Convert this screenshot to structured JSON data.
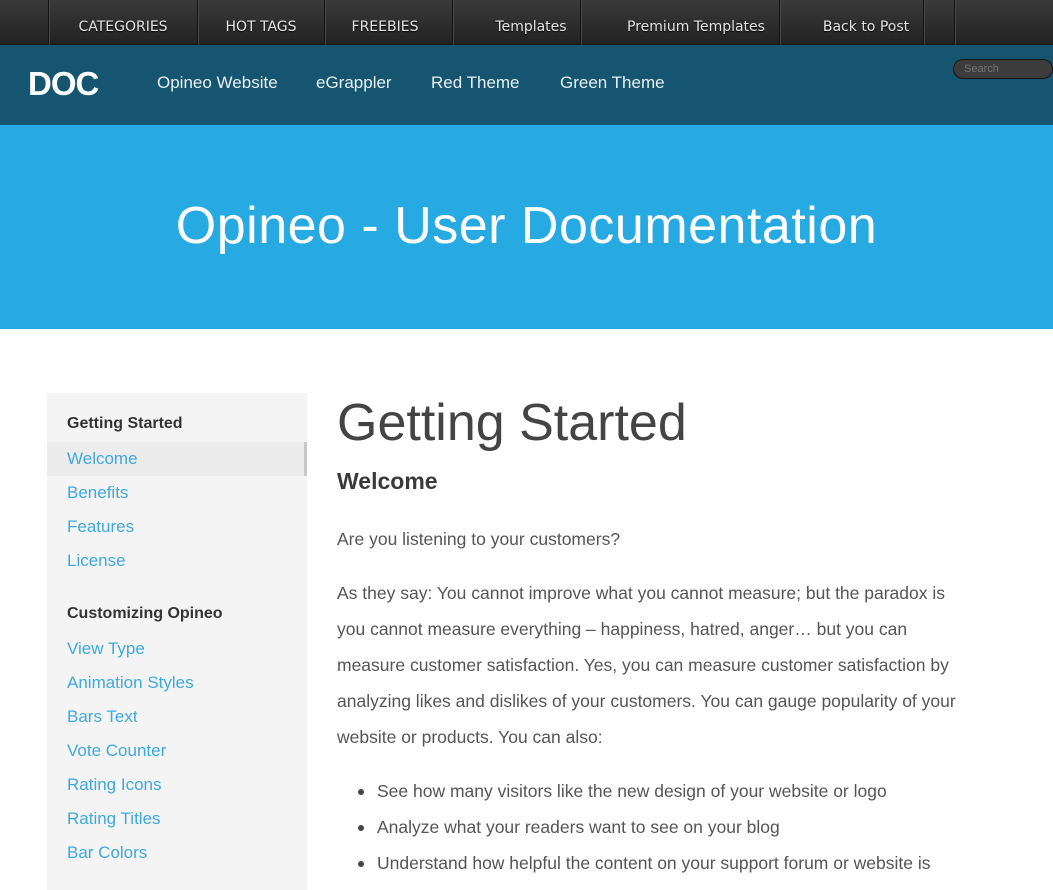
{
  "topbar": {
    "items": [
      {
        "label": "CATEGORIES"
      },
      {
        "label": "HOT TAGS"
      },
      {
        "label": "FREEBIES"
      },
      {
        "label": "Templates"
      },
      {
        "label": "Premium Templates"
      },
      {
        "label": "Back to Post"
      }
    ]
  },
  "navbar": {
    "brand": "DOC",
    "links": [
      {
        "label": "Opineo Website"
      },
      {
        "label": "eGrappler"
      },
      {
        "label": "Red Theme"
      },
      {
        "label": "Green Theme"
      }
    ],
    "search_placeholder": "Search"
  },
  "hero": {
    "title": "Opineo - User Documentation"
  },
  "sidebar": {
    "sections": [
      {
        "heading": "Getting Started",
        "items": [
          {
            "label": "Welcome",
            "active": true
          },
          {
            "label": "Benefits"
          },
          {
            "label": "Features"
          },
          {
            "label": "License"
          }
        ]
      },
      {
        "heading": "Customizing Opineo",
        "items": [
          {
            "label": "View Type"
          },
          {
            "label": "Animation Styles"
          },
          {
            "label": "Bars Text"
          },
          {
            "label": "Vote Counter"
          },
          {
            "label": "Rating Icons"
          },
          {
            "label": "Rating Titles"
          },
          {
            "label": "Bar Colors"
          }
        ]
      }
    ]
  },
  "main": {
    "title": "Getting Started",
    "subtitle": "Welcome",
    "intro": "Are you listening to your customers?",
    "paragraph_lines": [
      "As they say: You cannot improve what you cannot measure; but the paradox is",
      "you cannot measure everything – happiness, hatred, anger… but you can",
      "measure customer satisfaction. Yes, you can measure customer satisfaction by",
      "analyzing likes and dislikes of your customers. You can gauge popularity of your",
      "website or products. You can also:"
    ],
    "bullets": [
      "See how many visitors like the new design of your website or logo",
      "Analyze what your readers want to see on your blog",
      "Understand how helpful the content on your support forum or website is"
    ]
  },
  "colors": {
    "topbar": "#2c2c2c",
    "navbar": "#155570",
    "hero": "#27aae1",
    "link": "#3fa9dc",
    "sidebar_bg": "#f4f4f4"
  }
}
